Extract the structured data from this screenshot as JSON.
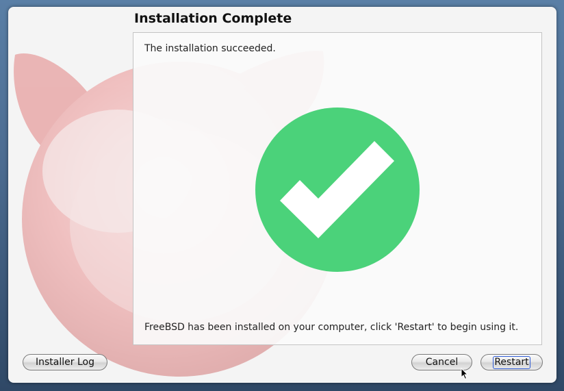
{
  "window": {
    "title": "Installation Complete"
  },
  "panel": {
    "status_text": "The installation succeeded.",
    "info_text": "FreeBSD has been installed on your computer, click 'Restart' to begin using it.",
    "status_icon": "checkmark-success-icon"
  },
  "buttons": {
    "installer_log": "Installer Log",
    "cancel": "Cancel",
    "restart": "Restart"
  },
  "colors": {
    "success_green": "#4bd27a",
    "mascot_red": "#e04040"
  }
}
